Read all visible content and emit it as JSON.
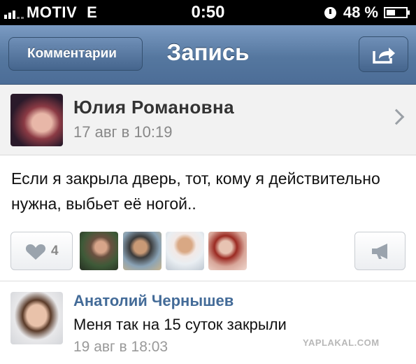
{
  "status_bar": {
    "carrier": "MOTIV",
    "network": "E",
    "time": "0:50",
    "battery": "48 %",
    "battery_level": 0.48
  },
  "nav": {
    "back_label": "Комментарии",
    "title": "Запись"
  },
  "post": {
    "author": "Юлия Романовна",
    "time": "17 авг в 10:19",
    "text": "Если я закрыла дверь, тот, кому я действительно нужна, выбьет её ногой..",
    "likes": "4"
  },
  "comment": {
    "author": "Анатолий Чернышев",
    "text": "Меня так на 15 суток закрыли",
    "time": "19 авг в 18:03"
  },
  "watermark": "YAPLAKAL.COM",
  "colors": {
    "nav_bar": "#5a7ca6",
    "comment_author": "#436b98",
    "header_bg": "#f2f2f2"
  },
  "icons": [
    "signal-icon",
    "clock-icon",
    "battery-icon",
    "share-icon",
    "chevron-right-icon",
    "heart-icon",
    "megaphone-icon"
  ]
}
